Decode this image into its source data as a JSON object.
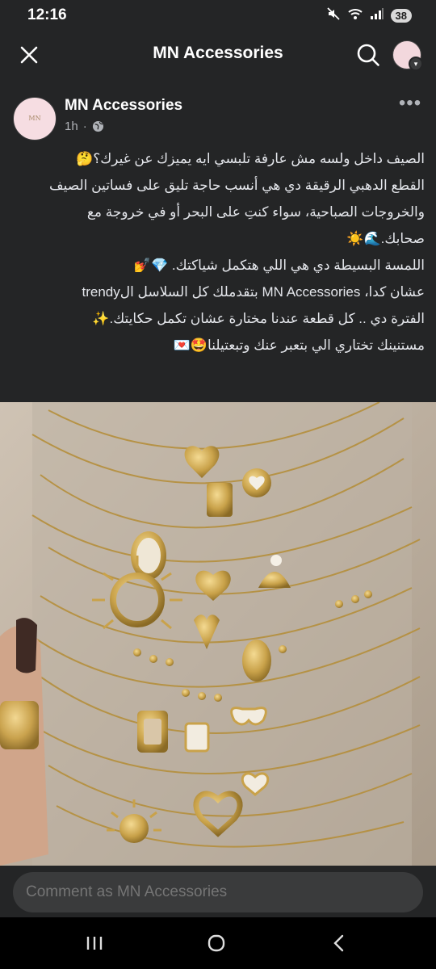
{
  "status_bar": {
    "time": "12:16",
    "battery": "38"
  },
  "app_bar": {
    "title": "MN Accessories"
  },
  "post": {
    "author": "MN Accessories",
    "time_ago": "1h",
    "avatar_text": "MN",
    "lines": [
      "الصيف داخل ولسه مش عارفة تلبسي ايه يميزك عن غيرك؟🤔",
      "القطع الدهبي الرقيقة دي هي أنسب حاجة تليق على فساتين الصيف",
      "والخروجات الصباحية، سواء كنتِ على البحر أو في خروجة مع",
      "صحابك.🌊☀️",
      "اللمسة البسيطة دي هي اللي هتكمل شياكتك. 💎💅",
      "عشان كدا، MN Accessories بتقدملك كل السلاسل الtrendy",
      "الفترة دي .. كل قطعة عندنا مختارة عشان تكمل حكايتك.✨",
      "مستنينك تختاري الي بتعبر عنك وتبعتيلنا🤩💌"
    ]
  },
  "comment": {
    "placeholder": "Comment as MN Accessories"
  },
  "icons": {
    "close": "close-icon",
    "search": "search-icon",
    "more": "more-icon",
    "globe": "globe-icon",
    "recents": "recents-icon",
    "home": "home-icon",
    "back": "back-icon"
  },
  "colors": {
    "surface": "#242526",
    "input": "#3a3b3c",
    "text": "#e4e6eb",
    "muted": "#b0b3b8",
    "gold": "#c9a24a"
  }
}
